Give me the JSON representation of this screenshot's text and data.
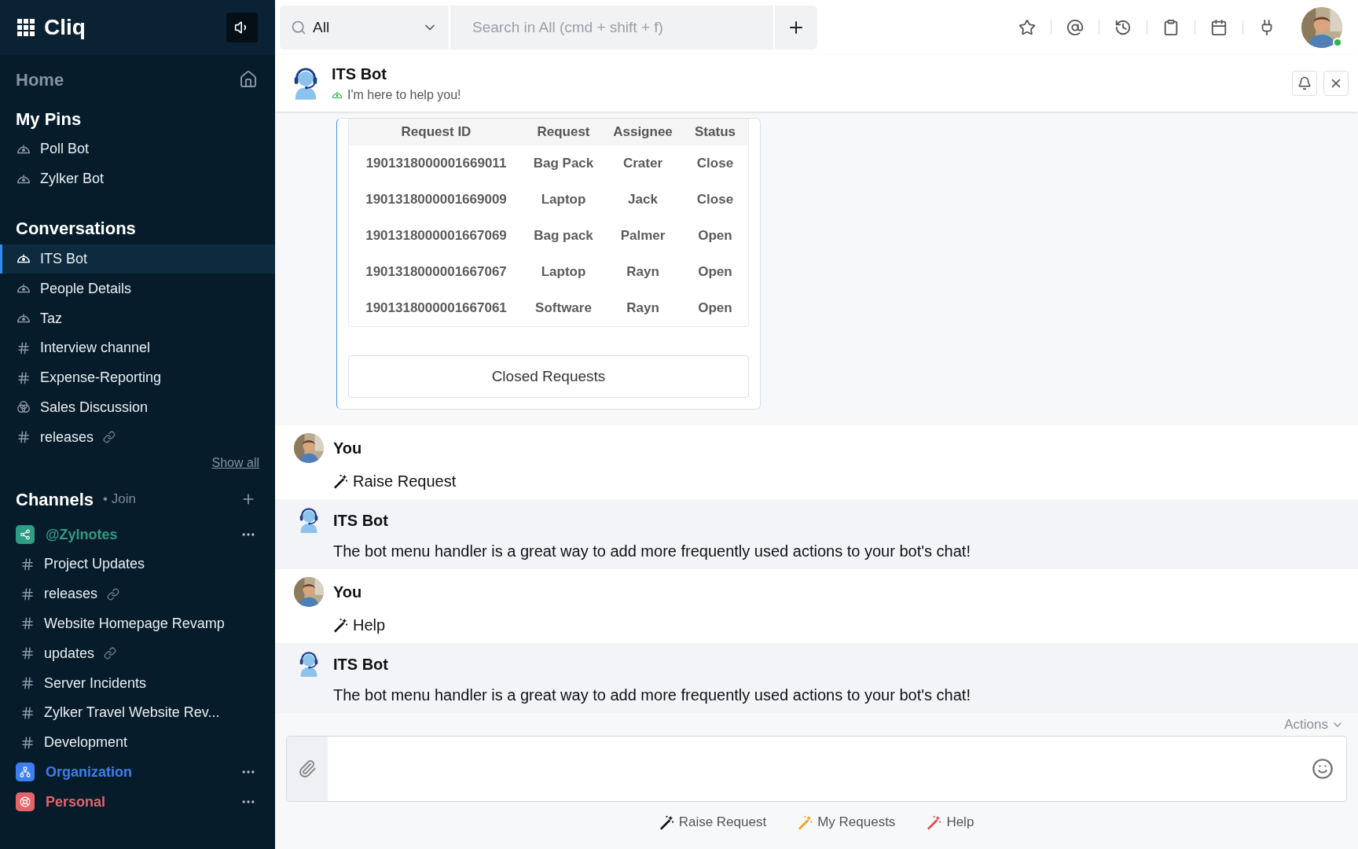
{
  "app": {
    "name": "Cliq"
  },
  "sidebar": {
    "home": "Home",
    "pins": {
      "title": "My Pins",
      "items": [
        {
          "label": "Poll Bot",
          "kind": "bot",
          "selected": false,
          "shared": false
        },
        {
          "label": "Zylker Bot",
          "kind": "bot",
          "selected": false,
          "shared": false
        }
      ]
    },
    "conversations": {
      "title": "Conversations",
      "show_all": "Show all",
      "items": [
        {
          "label": "ITS Bot",
          "kind": "bot",
          "selected": true,
          "shared": false
        },
        {
          "label": "People Details",
          "kind": "bot",
          "selected": false,
          "shared": false
        },
        {
          "label": "Taz",
          "kind": "bot",
          "selected": false,
          "shared": false
        },
        {
          "label": "Interview channel",
          "kind": "channel",
          "selected": false,
          "shared": false
        },
        {
          "label": "Expense-Reporting",
          "kind": "channel",
          "selected": false,
          "shared": false
        },
        {
          "label": "Sales Discussion",
          "kind": "group",
          "selected": false,
          "shared": false
        },
        {
          "label": "releases",
          "kind": "channel",
          "selected": false,
          "shared": true
        }
      ]
    },
    "channels": {
      "title": "Channels",
      "join": "• Join",
      "groups": [
        {
          "label": "@Zylnotes",
          "kind": "team",
          "color": "#2f9c86",
          "items": [
            {
              "label": "Project Updates",
              "shared": false
            },
            {
              "label": "releases",
              "shared": true
            },
            {
              "label": "Website Homepage Revamp",
              "shared": false
            },
            {
              "label": "updates",
              "shared": true
            },
            {
              "label": "Server Incidents",
              "shared": false
            },
            {
              "label": "Zylker Travel Website Rev...",
              "shared": false
            },
            {
              "label": "Development",
              "shared": false
            }
          ]
        },
        {
          "label": "Organization",
          "kind": "organization",
          "color": "#3d7ff0"
        },
        {
          "label": "Personal",
          "kind": "personal",
          "color": "#e5646a"
        }
      ]
    }
  },
  "topbar": {
    "scope": "All",
    "placeholder": "Search in All (cmd + shift + f)",
    "online": true
  },
  "chat": {
    "title": "ITS Bot",
    "status": "I'm here to help you!",
    "table": {
      "columns": [
        "Request ID",
        "Request",
        "Assignee",
        "Status"
      ],
      "rows": [
        [
          "1901318000001669011",
          "Bag Pack",
          "Crater",
          "Close"
        ],
        [
          "1901318000001669009",
          "Laptop",
          "Jack",
          "Close"
        ],
        [
          "1901318000001667069",
          "Bag pack",
          "Palmer",
          "Open"
        ],
        [
          "1901318000001667067",
          "Laptop",
          "Rayn",
          "Open"
        ],
        [
          "1901318000001667061",
          "Software",
          "Rayn",
          "Open"
        ]
      ],
      "button": "Closed Requests"
    },
    "messages": [
      {
        "kind": "user",
        "sender": "You",
        "text": "Raise Request"
      },
      {
        "kind": "bot",
        "sender": "ITS Bot",
        "text": "The bot menu handler is a great way to add more frequently used actions to your bot's chat!"
      },
      {
        "kind": "user",
        "sender": "You",
        "text": "Help"
      },
      {
        "kind": "bot",
        "sender": "ITS Bot",
        "text": "The bot menu handler is a great way to add more frequently used actions to your bot's chat!"
      }
    ]
  },
  "composer": {
    "actions": "Actions",
    "quick_actions": [
      {
        "label": "Raise Request",
        "color": "#111111"
      },
      {
        "label": "My Requests",
        "color": "#f0a020"
      },
      {
        "label": "Help",
        "color": "#e5464a"
      }
    ]
  }
}
